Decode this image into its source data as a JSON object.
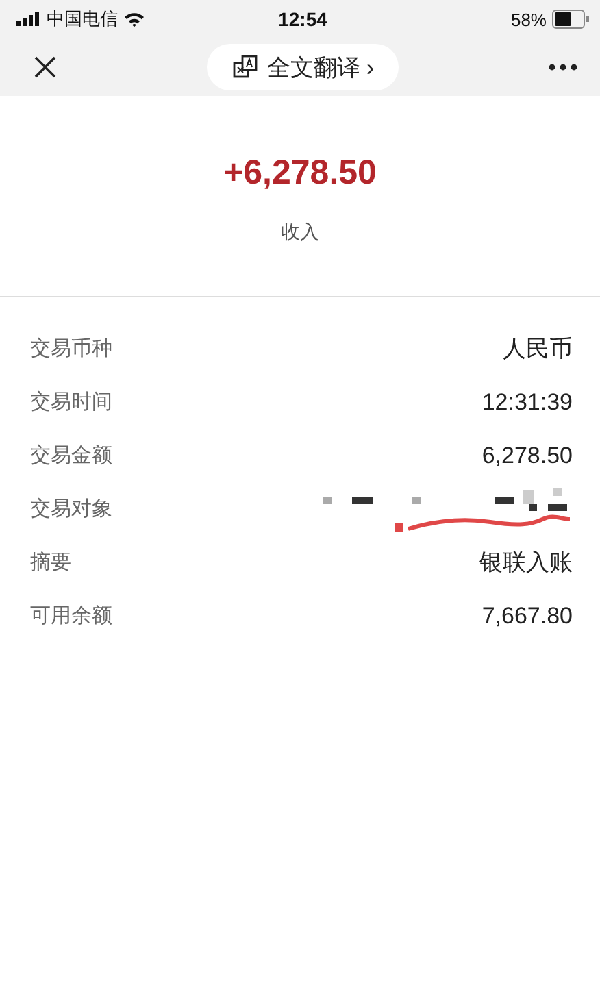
{
  "status_bar": {
    "carrier": "中国电信",
    "time": "12:54",
    "battery": "58%"
  },
  "nav": {
    "translate_label": "全文翻译 ›"
  },
  "summary": {
    "amount": "+6,278.50",
    "type": "收入"
  },
  "details": [
    {
      "kind": "text",
      "label": "交易币种",
      "value": "人民币"
    },
    {
      "kind": "text",
      "label": "交易时间",
      "value": "12:31:39"
    },
    {
      "kind": "text",
      "label": "交易金额",
      "value": "6,278.50"
    },
    {
      "kind": "redacted",
      "label": "交易对象"
    },
    {
      "kind": "text",
      "label": "摘要",
      "value": "银联入账"
    },
    {
      "kind": "text",
      "label": "可用余额",
      "value": "7,667.80"
    }
  ]
}
